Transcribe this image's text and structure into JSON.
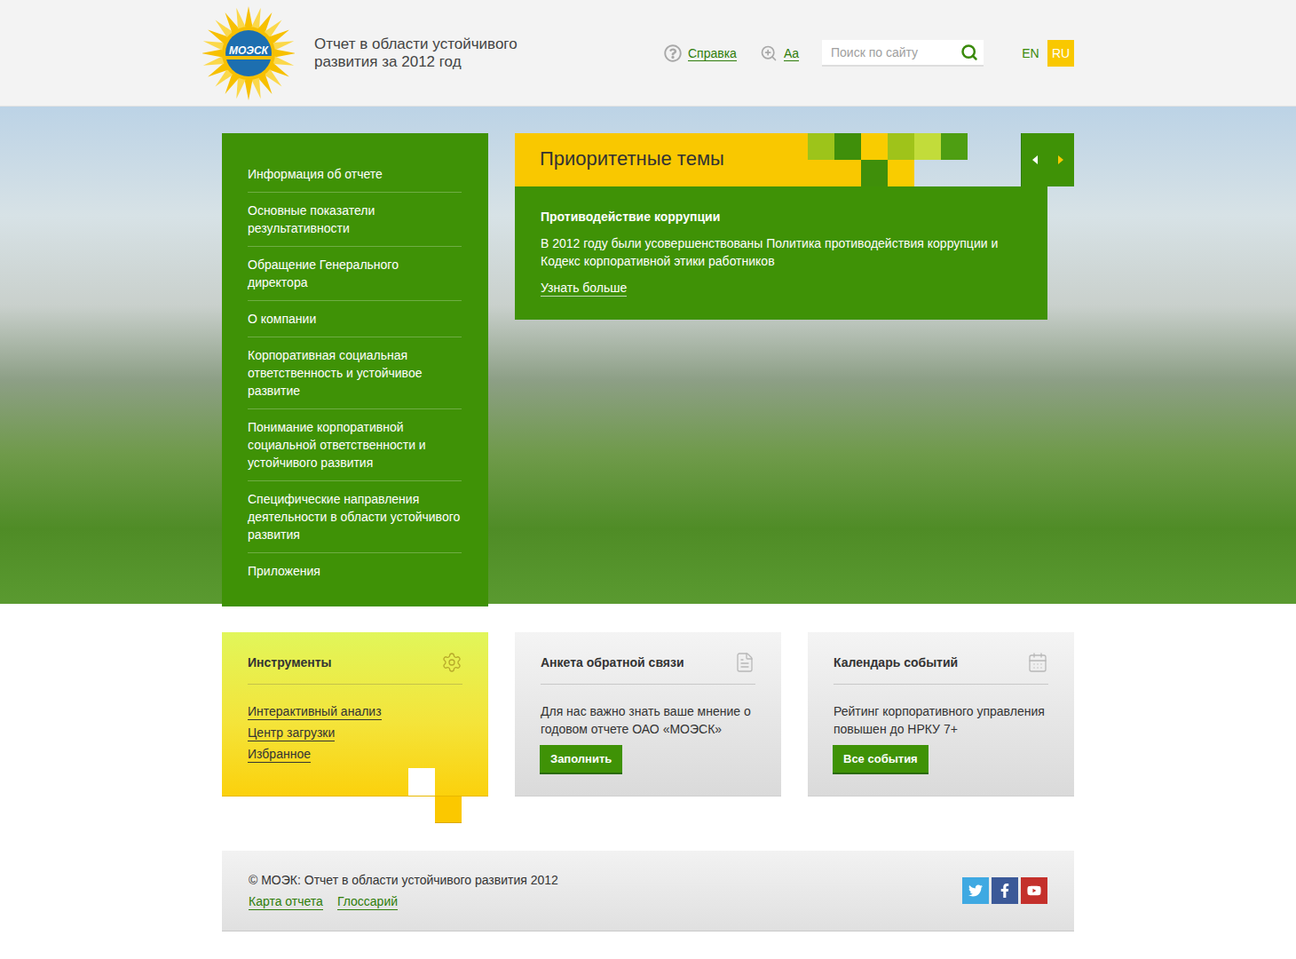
{
  "header": {
    "logo": "МОЭСК",
    "title": "Отчет в области устойчивого развития за 2012 год",
    "help": "Справка",
    "font_size": "Aa",
    "search": {
      "placeholder": "Поиск по сайту"
    },
    "languages": [
      {
        "label": "EN",
        "selected": false
      },
      {
        "label": "RU",
        "selected": true
      }
    ]
  },
  "menu": {
    "items": [
      "Информация об отчете",
      "Основные показатели результативности",
      "Обращение Генерального директора",
      "О компании",
      "Корпоративная социальная ответственность и устойчивое развитие",
      "Понимание корпоративной социальной ответственности и устойчивого развития",
      "Специфические направления деятельности в области устойчивого развития",
      "Приложения"
    ]
  },
  "priority": {
    "title": "Приоритетные темы",
    "item": {
      "title": "Противодействие коррупции",
      "text": "В 2012 году были усовершенствованы Политика противодействия коррупции и Кодекс корпоративной этики работников",
      "link": "Узнать больше"
    }
  },
  "cards": [
    {
      "kind": "tools",
      "title": "Инструменты",
      "links": [
        "Интерактивный анализ",
        "Центр загрузки",
        "Избранное"
      ]
    },
    {
      "kind": "feedback",
      "title": "Анкета обратной связи",
      "text": "Для нас важно знать ваше мнение о годовом отчете ОАО «МОЭСК»",
      "button": "Заполнить"
    },
    {
      "kind": "events",
      "title": "Календарь событий",
      "text": "Рейтинг корпоративного управления повышен до НРКУ 7+",
      "button": "Все события"
    }
  ],
  "footer": {
    "copyright": "© МОЭК: Отчет в области устойчивого развития 2012",
    "links": [
      "Карта отчета",
      "Глоссарий"
    ],
    "social": [
      "twitter",
      "facebook",
      "youtube"
    ]
  }
}
